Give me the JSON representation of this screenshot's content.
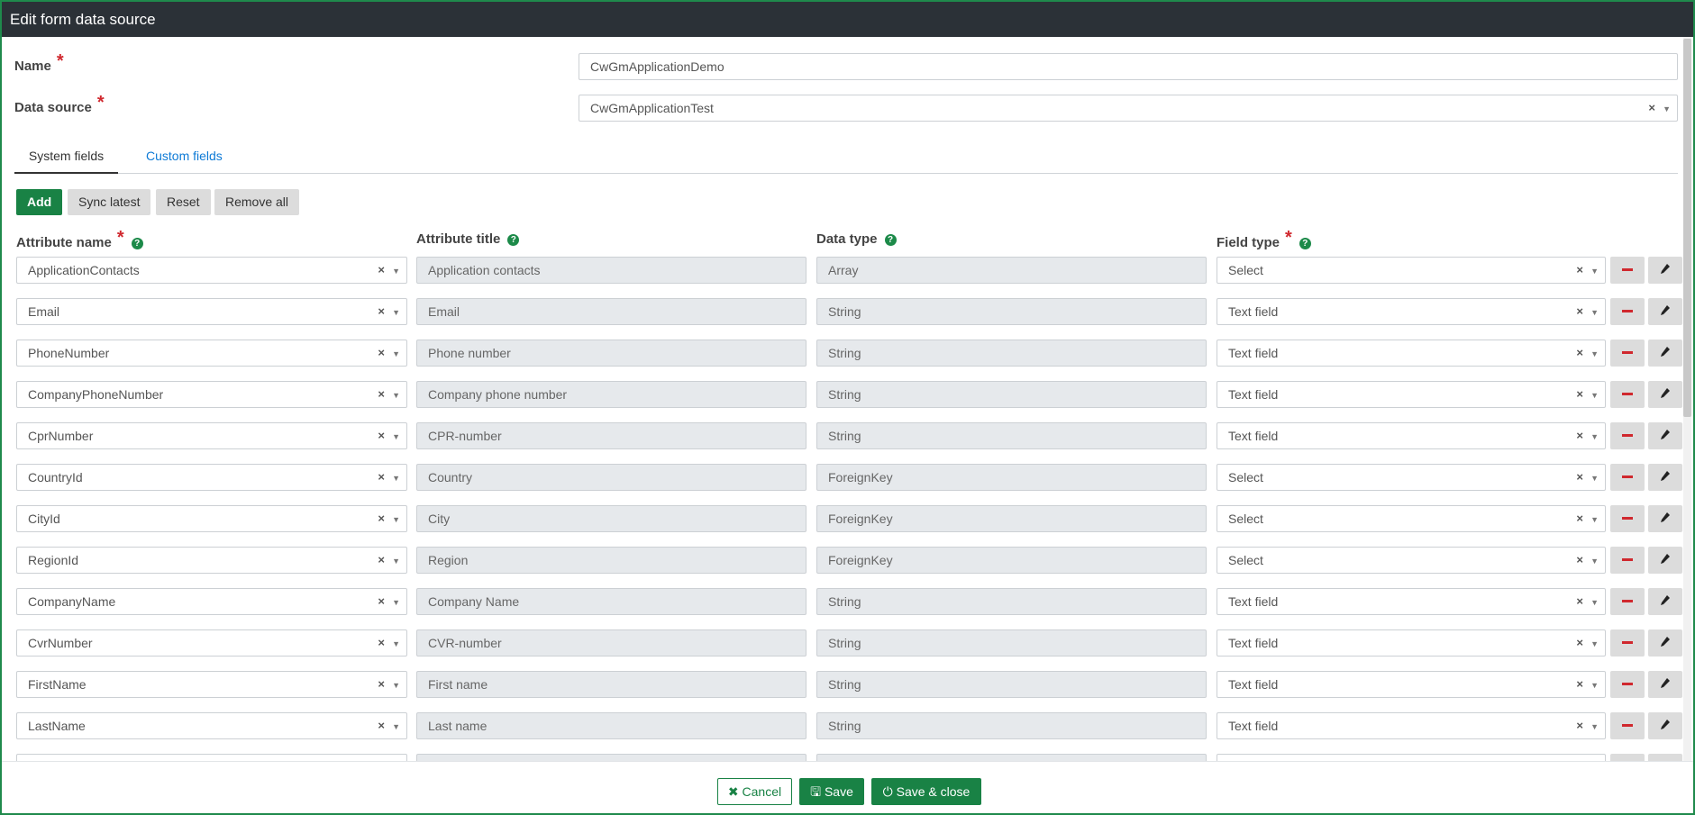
{
  "window": {
    "title": "Edit form data source"
  },
  "form": {
    "name_label": "Name",
    "name_value": "CwGmApplicationDemo",
    "datasource_label": "Data source",
    "datasource_value": "CwGmApplicationTest",
    "required_mark": "*"
  },
  "tabs": [
    {
      "label": "System fields",
      "active": true
    },
    {
      "label": "Custom fields",
      "active": false
    }
  ],
  "toolbar": {
    "add": "Add",
    "sync": "Sync latest",
    "reset": "Reset",
    "remove_all": "Remove all"
  },
  "columns": {
    "attribute_name": "Attribute name",
    "attribute_title": "Attribute title",
    "data_type": "Data type",
    "field_type": "Field type"
  },
  "rows": [
    {
      "name": "ApplicationContacts",
      "title": "Application contacts",
      "type": "Array",
      "field": "Select"
    },
    {
      "name": "Email",
      "title": "Email",
      "type": "String",
      "field": "Text field"
    },
    {
      "name": "PhoneNumber",
      "title": "Phone number",
      "type": "String",
      "field": "Text field"
    },
    {
      "name": "CompanyPhoneNumber",
      "title": "Company phone number",
      "type": "String",
      "field": "Text field"
    },
    {
      "name": "CprNumber",
      "title": "CPR-number",
      "type": "String",
      "field": "Text field"
    },
    {
      "name": "CountryId",
      "title": "Country",
      "type": "ForeignKey",
      "field": "Select"
    },
    {
      "name": "CityId",
      "title": "City",
      "type": "ForeignKey",
      "field": "Select"
    },
    {
      "name": "RegionId",
      "title": "Region",
      "type": "ForeignKey",
      "field": "Select"
    },
    {
      "name": "CompanyName",
      "title": "Company Name",
      "type": "String",
      "field": "Text field"
    },
    {
      "name": "CvrNumber",
      "title": "CVR-number",
      "type": "String",
      "field": "Text field"
    },
    {
      "name": "FirstName",
      "title": "First name",
      "type": "String",
      "field": "Text field"
    },
    {
      "name": "LastName",
      "title": "Last name",
      "type": "String",
      "field": "Text field"
    }
  ],
  "footer": {
    "cancel": "Cancel",
    "save": "Save",
    "save_close": "Save & close"
  },
  "colors": {
    "accent": "#198245",
    "titlebar": "#2b3137",
    "danger": "#d0282e",
    "link": "#0d7ad6"
  }
}
